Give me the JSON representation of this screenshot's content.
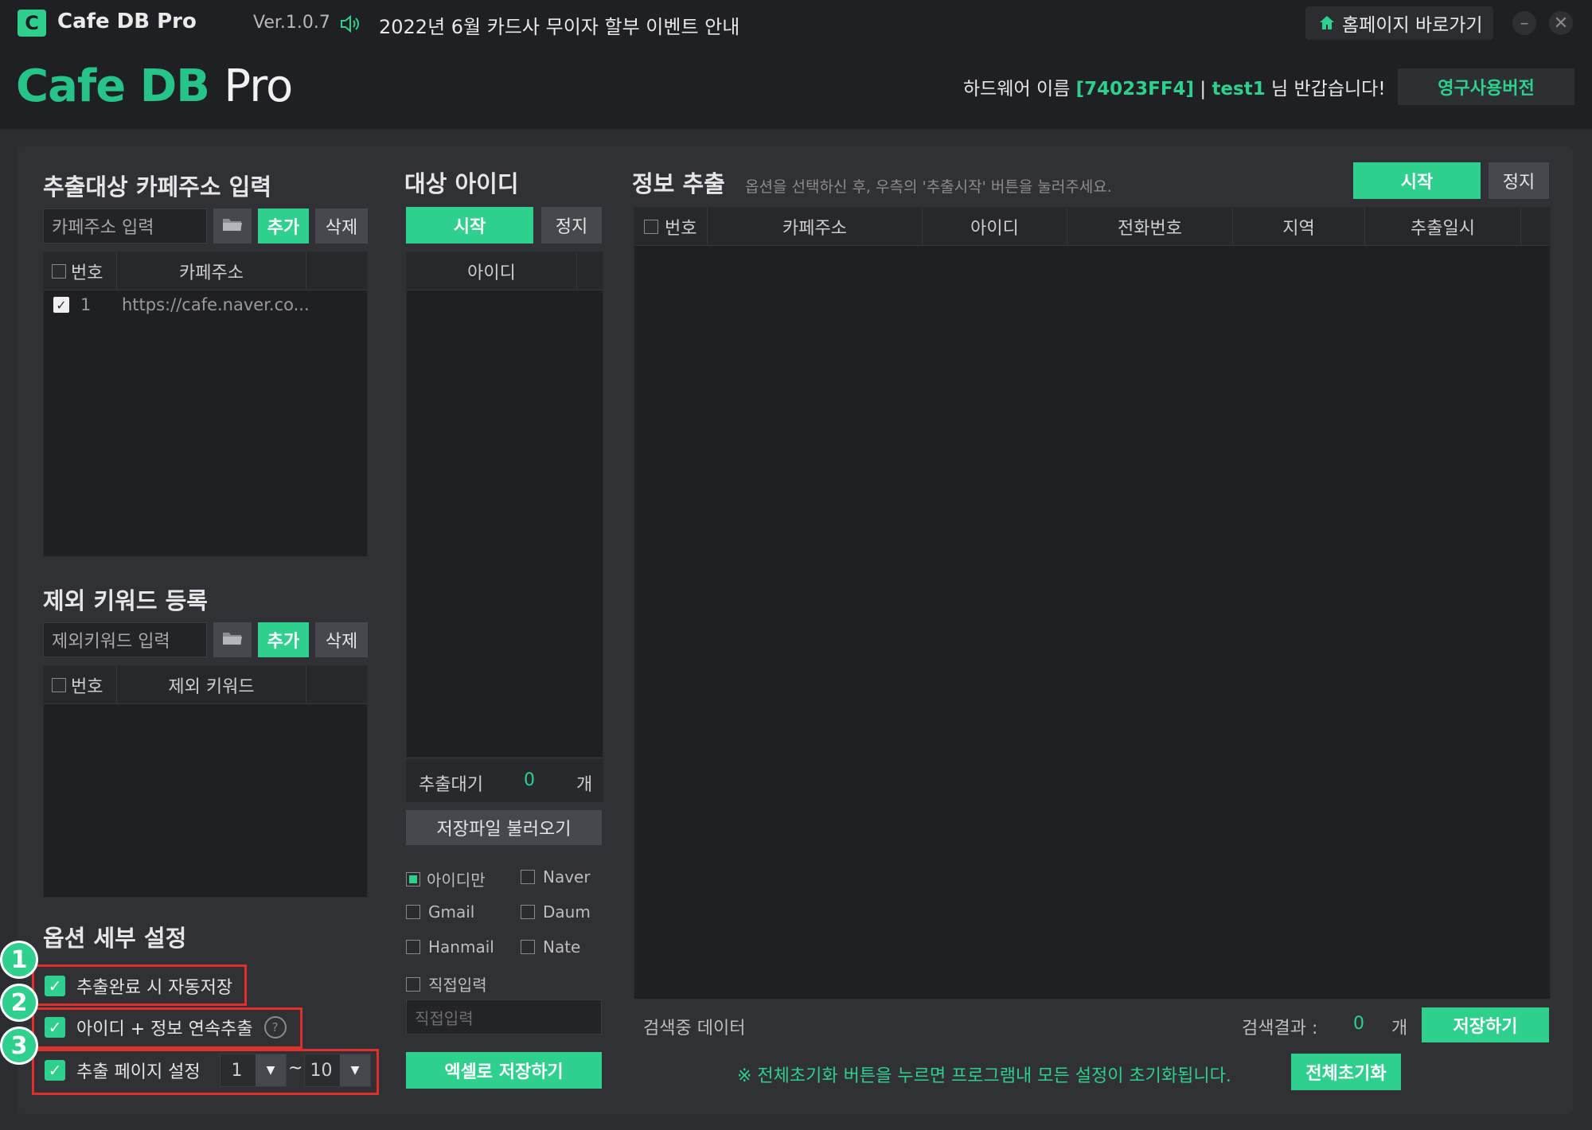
{
  "titlebar": {
    "app_name": "Cafe DB Pro",
    "version": "Ver.1.0.7",
    "notice": "2022년 6월 카드사 무이자 할부 이벤트 안내",
    "home_button": "홈페이지 바로가기",
    "minimize": "–",
    "close": "✕"
  },
  "header": {
    "logo_main": "Cafe DB",
    "logo_pro": "Pro",
    "hw_prefix": "하드웨어 이름",
    "hw_id": "[74023FF4]",
    "separator": "|",
    "user": "test1",
    "greeting": "님 반갑습니다!",
    "license_button": "영구사용버전"
  },
  "cafe_section": {
    "title": "추출대상 카페주소 입력",
    "input_placeholder": "카페주소 입력",
    "add": "추가",
    "delete": "삭제",
    "columns": [
      "번호",
      "카페주소"
    ],
    "rows": [
      {
        "no": "1",
        "url": "https://cafe.naver.co..."
      }
    ]
  },
  "keyword_section": {
    "title": "제외 키워드 등록",
    "input_placeholder": "제외키워드 입력",
    "add": "추가",
    "delete": "삭제",
    "columns": [
      "번호",
      "제외 키워드"
    ]
  },
  "options_section": {
    "title": "옵션 세부 설정",
    "markers": [
      "1",
      "2",
      "3"
    ],
    "opt1": "추출완료 시 자동저장",
    "opt2": "아이디 + 정보 연속추출",
    "opt2_help": "?",
    "opt3": "추출 페이지 설정",
    "page_from": "1",
    "page_tilde": "~",
    "page_to": "10"
  },
  "target_section": {
    "title": "대상 아이디",
    "start": "시작",
    "stop": "정지",
    "column": "아이디",
    "waiting_label": "추출대기",
    "waiting_count": "0",
    "unit": "개",
    "load_button": "저장파일 불러오기",
    "checks": {
      "id_only": "아이디만",
      "naver": "Naver",
      "gmail": "Gmail",
      "daum": "Daum",
      "hanmail": "Hanmail",
      "nate": "Nate",
      "direct": "직접입력"
    },
    "direct_placeholder": "직접입력",
    "excel_button": "엑셀로 저장하기"
  },
  "info_section": {
    "title": "정보 추출",
    "hint": "옵션을 선택하신 후, 우측의 '추출시작' 버튼을 눌러주세요.",
    "start": "시작",
    "stop": "정지",
    "columns": [
      "번호",
      "카페주소",
      "아이디",
      "전화번호",
      "지역",
      "추출일시"
    ],
    "searching": "검색중 데이터",
    "result_label": "검색결과 :",
    "result_count": "0",
    "unit": "개",
    "save_button": "저장하기",
    "reset_warning": "※ 전체초기화 버튼을 누르면 프로그램내 모든 설정이 초기화됩니다.",
    "reset_button": "전체초기화"
  },
  "colors": {
    "accent": "#2fcf8e",
    "highlight": "#e0302b",
    "background": "#2b2d30"
  }
}
